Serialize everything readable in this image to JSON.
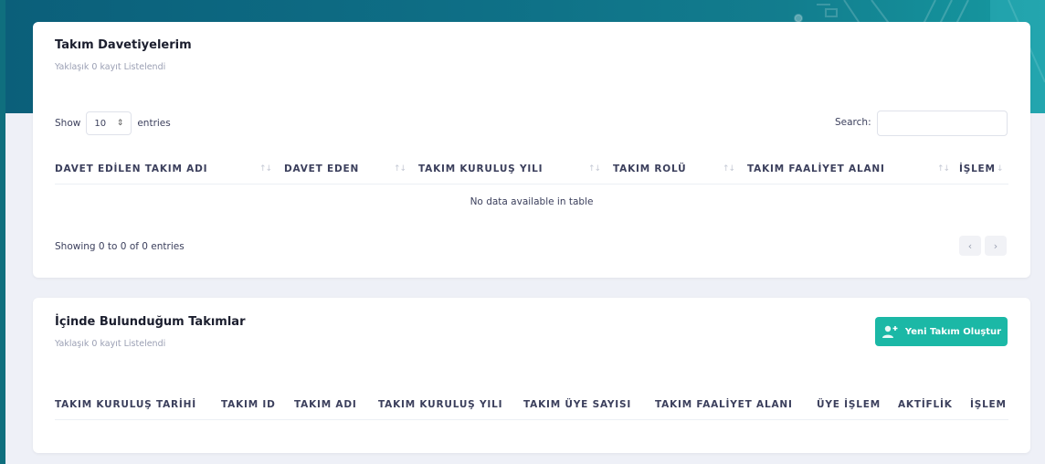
{
  "colors": {
    "hero_start": "#0b5f7a",
    "hero_end": "#169aa1",
    "accent_button": "#1bb8a6"
  },
  "invites": {
    "title": "Takım Davetiyelerim",
    "subtitle": "Yaklaşık 0 kayıt Listelendi",
    "show_label": "Show",
    "length_value": "10",
    "entries_label": "entries",
    "search_label": "Search:",
    "search_placeholder": "",
    "columns": [
      "DAVET EDİLEN TAKIM ADI",
      "DAVET EDEN",
      "TAKIM KURULUŞ YILI",
      "TAKIM ROLÜ",
      "TAKIM FAALİYET ALANI",
      "İŞLEM"
    ],
    "sort_glyph": "↑↓",
    "empty_text": "No data available in table",
    "info_text": "Showing 0 to 0 of 0 entries",
    "prev_icon": "‹",
    "next_icon": "›"
  },
  "teams": {
    "title": "İçinde Bulunduğum Takımlar",
    "subtitle": "Yaklaşık 0 kayıt Listelendi",
    "new_button_label": "Yeni Takım Oluştur",
    "new_button_icon": "add-user-icon",
    "columns": [
      "TAKIM KURULUŞ TARİHİ",
      "TAKIM ID",
      "TAKIM ADI",
      "TAKIM KURULUŞ YILI",
      "TAKIM ÜYE SAYISI",
      "TAKIM FAALİYET ALANI",
      "ÜYE İŞLEM",
      "AKTİFLİK",
      "İŞLEM"
    ]
  }
}
